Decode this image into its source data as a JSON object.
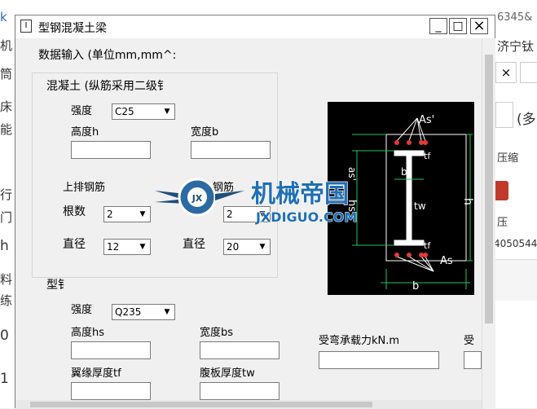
{
  "background": {
    "left_chars": [
      "k",
      "机",
      "筒",
      "床",
      "能",
      "行",
      "门",
      "h",
      "料",
      "练",
      "0",
      "1"
    ],
    "right_top": "6345&",
    "right_link": "济宁钛",
    "right_paren": "(多",
    "right_label1": "压缩",
    "right_label2": "压",
    "right_number": "4050544",
    "right_close": "×"
  },
  "window": {
    "icon": "I",
    "title": "型钢混凝土梁",
    "min": "_",
    "max": "□",
    "close": "×"
  },
  "form": {
    "heading": "数据输入 (单位mm,mm^:",
    "concrete_group": "混凝土 (纵筋采用二级钅",
    "strength_label": "强度",
    "strength_value": "C25",
    "height_label": "高度h",
    "width_label": "宽度b",
    "top_rebar_label": "上排钢筋",
    "bottom_rebar_label": "钢筋",
    "count_label_1": "根数",
    "count_value_1": "2",
    "count_value_2": "2",
    "diameter_label_1": "直径",
    "diameter_value_1": "12",
    "diameter_label_2": "直径",
    "diameter_value_2": "20",
    "steel_group": "型钅",
    "steel_strength_label": "强度",
    "steel_strength_value": "Q235",
    "steel_height_label": "高度hs",
    "steel_width_label": "宽度bs",
    "flange_label": "翼缘厚度tf",
    "web_label": "腹板厚度tw",
    "moment_label": "受弯承载力kN.m",
    "shear_label": "受"
  },
  "diagram": {
    "as_top": "As'",
    "as_bottom": "As",
    "as_prime_side": "as'",
    "tf_top": "tf",
    "tf_bottom": "tf",
    "bs": "bs",
    "tw": "tw",
    "hs": "hs",
    "h": "h",
    "b": "b"
  },
  "watermark": {
    "cn": "机械帝国",
    "en": "JXDIGUO.COM",
    "badge": "JX"
  }
}
